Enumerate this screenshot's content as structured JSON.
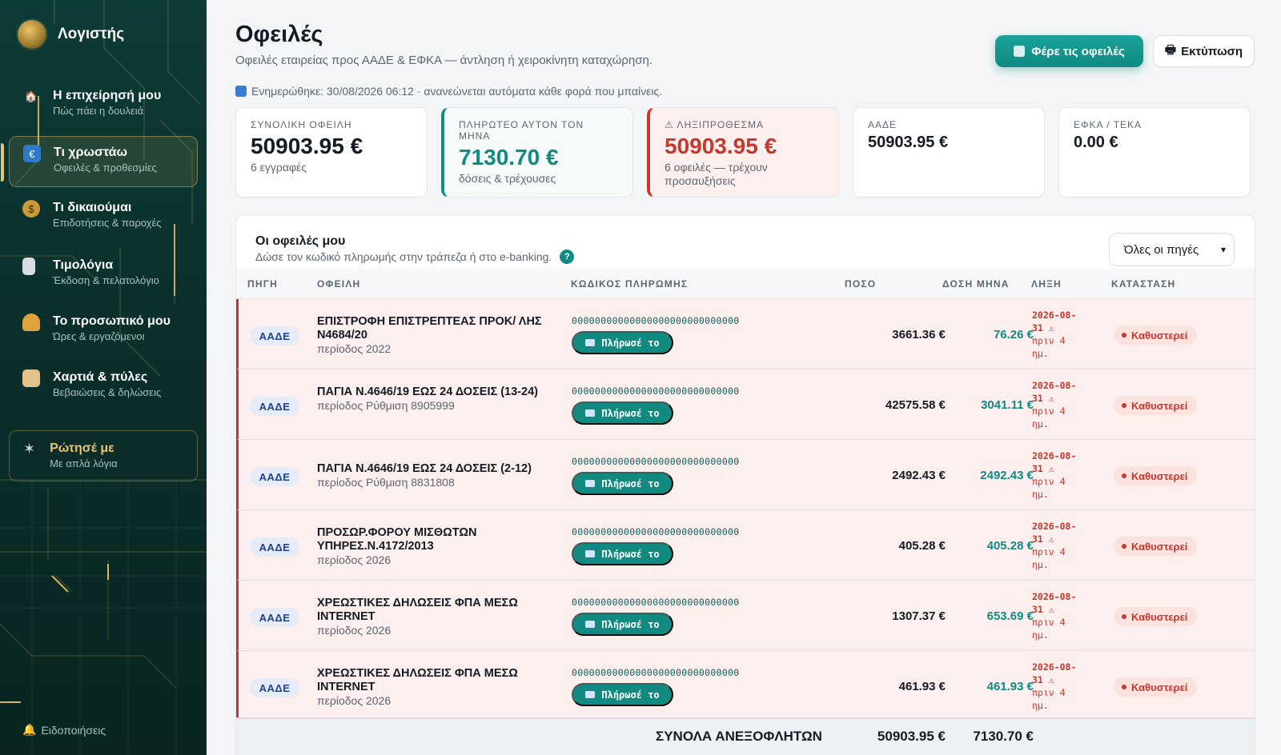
{
  "app": {
    "name": "Λογιστής"
  },
  "sidebar": {
    "items": [
      {
        "label": "Η επιχείρησή μου",
        "sub": "Πώς πάει η δουλειά",
        "icon": "house-icon"
      },
      {
        "label": "Τι χρωστάω",
        "sub": "Οφειλές & προθεσμίες",
        "icon": "money-icon",
        "active": true
      },
      {
        "label": "Τι δικαιούμαι",
        "sub": "Επιδοτήσεις & παροχές",
        "icon": "moneybag-icon"
      },
      {
        "label": "Τιμολόγια",
        "sub": "Έκδοση & πελατολόγιο",
        "icon": "receipt-icon"
      },
      {
        "label": "Το προσωπικό μου",
        "sub": "Ώρες & εργαζόμενοι",
        "icon": "worker-icon"
      },
      {
        "label": "Χαρτιά & πύλες",
        "sub": "Βεβαιώσεις & δηλώσεις",
        "icon": "scroll-icon"
      }
    ],
    "ask": {
      "label": "Ρώτησέ με",
      "sub": "Με απλά λόγια"
    },
    "notifications": "Ειδοποιήσεις"
  },
  "page": {
    "title": "Οφειλές",
    "subtitle": "Οφειλές εταιρείας προς ΑΑΔΕ & ΕΦΚΑ — άντληση ή χειροκίνητη καταχώρηση.",
    "updated": "Ενημερώθηκε: 30/08/2026 06:12 · ανανεώνεται αυτόματα κάθε φορά που μπαίνεις.",
    "fetch_button": "Φέρε τις οφειλές",
    "print_button": "Εκτύπωση"
  },
  "cards": [
    {
      "label": "ΣΥΝΟΛΙΚΗ ΟΦΕΙΛΗ",
      "value": "50903.95 €",
      "sub": "6 εγγραφές"
    },
    {
      "label": "ΠΛΗΡΩΤΕΟ ΑΥΤΟΝ ΤΟΝ ΜΗΝΑ",
      "value": "7130.70 €",
      "sub": "δόσεις & τρέχουσες"
    },
    {
      "label": "⚠ ΛΗΞΙΠΡΟΘΕΣΜΑ",
      "value": "50903.95 €",
      "sub": "6 οφειλές — τρέχουν προσαυξήσεις"
    },
    {
      "label": "ΑΑΔΕ",
      "value": "50903.95 €",
      "sub": ""
    },
    {
      "label": "ΕΦΚΑ / ΤΕΚΑ",
      "value": "0.00 €",
      "sub": ""
    }
  ],
  "table": {
    "title": "Οι οφειλές μου",
    "subtitle": "Δώσε τον κωδικό πληρωμής στην τράπεζα ή στο e-banking.",
    "help": "?",
    "filter": {
      "selected": "Όλες οι πηγές"
    },
    "headers": [
      "ΠΗΓΗ",
      "ΟΦΕΙΛΗ",
      "ΚΩΔΙΚΟΣ ΠΛΗΡΩΜΗΣ",
      "ΠΟΣΟ",
      "ΔΟΣΗ ΜΗΝΑ",
      "ΛΗΞΗ",
      "ΚΑΤΑΣΤΑΣΗ"
    ],
    "rows": [
      {
        "source": "ΑΑΔΕ",
        "title": "ΕΠΙΣΤΡΟΦΗ ΕΠΙΣΤΡΕΠΤΕΑΣ ΠΡΟΚ/ ΛΗΣ Ν4684/20",
        "period": "περίοδος 2022",
        "code": "00000000000000000000000000000",
        "pay": "Πλήρωσέ το",
        "amount": "3661.36 €",
        "installment": "76.26 €",
        "due1": "2026-08-",
        "due2": "31 ⚠",
        "due3": "πριν 4",
        "due4": "ημ.",
        "status": "Καθυστερεί"
      },
      {
        "source": "ΑΑΔΕ",
        "title": "ΠΑΓΙΑ Ν.4646/19 ΕΩΣ 24 ΔΟΣΕΙΣ (13-24)",
        "period": "περίοδος Ρύθμιση 8905999",
        "code": "00000000000000000000000000000",
        "pay": "Πλήρωσέ το",
        "amount": "42575.58 €",
        "installment": "3041.11 €",
        "due1": "2026-08-",
        "due2": "31 ⚠",
        "due3": "πριν 4",
        "due4": "ημ.",
        "status": "Καθυστερεί"
      },
      {
        "source": "ΑΑΔΕ",
        "title": "ΠΑΓΙΑ Ν.4646/19 ΕΩΣ 24 ΔΟΣΕΙΣ (2-12)",
        "period": "περίοδος Ρύθμιση 8831808",
        "code": "00000000000000000000000000000",
        "pay": "Πλήρωσέ το",
        "amount": "2492.43 €",
        "installment": "2492.43 €",
        "due1": "2026-08-",
        "due2": "31 ⚠",
        "due3": "πριν 4",
        "due4": "ημ.",
        "status": "Καθυστερεί"
      },
      {
        "source": "ΑΑΔΕ",
        "title": "ΠΡΟΣΩΡ.ΦΟΡΟΥ ΜΙΣΘΩΤΩΝ ΥΠΗΡΕΣ.Ν.4172/2013",
        "period": "περίοδος 2026",
        "code": "00000000000000000000000000000",
        "pay": "Πλήρωσέ το",
        "amount": "405.28 €",
        "installment": "405.28 €",
        "due1": "2026-08-",
        "due2": "31 ⚠",
        "due3": "πριν 4",
        "due4": "ημ.",
        "status": "Καθυστερεί"
      },
      {
        "source": "ΑΑΔΕ",
        "title": "ΧΡΕΩΣΤΙΚΕΣ ΔΗΛΩΣΕΙΣ ΦΠΑ ΜΕΣΩ INTERNET",
        "period": "περίοδος 2026",
        "code": "00000000000000000000000000000",
        "pay": "Πλήρωσέ το",
        "amount": "1307.37 €",
        "installment": "653.69 €",
        "due1": "2026-08-",
        "due2": "31 ⚠",
        "due3": "πριν 4",
        "due4": "ημ.",
        "status": "Καθυστερεί"
      },
      {
        "source": "ΑΑΔΕ",
        "title": "ΧΡΕΩΣΤΙΚΕΣ ΔΗΛΩΣΕΙΣ ΦΠΑ ΜΕΣΩ INTERNET",
        "period": "περίοδος 2026",
        "code": "00000000000000000000000000000",
        "pay": "Πλήρωσέ το",
        "amount": "461.93 €",
        "installment": "461.93 €",
        "due1": "2026-08-",
        "due2": "31 ⚠",
        "due3": "πριν 4",
        "due4": "ημ.",
        "status": "Καθυστερεί"
      }
    ],
    "totals": {
      "label": "ΣΥΝΟΛΑ ΑΝΕΞΟΦΛΗΤΩΝ",
      "amount": "50903.95 €",
      "installment": "7130.70 €"
    }
  },
  "colors": {
    "accent": "#118a82",
    "danger": "#c8372d",
    "gold": "#e9c46a",
    "sidebar": "#0d3b36"
  }
}
